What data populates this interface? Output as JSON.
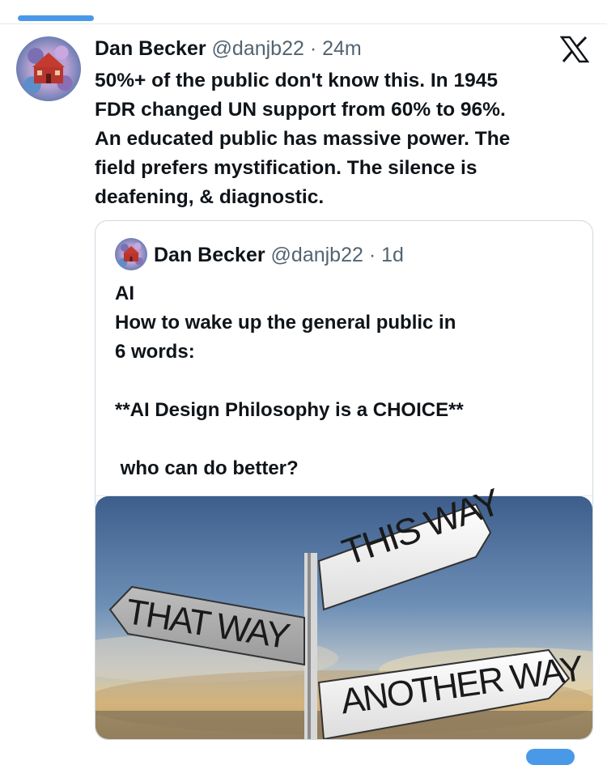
{
  "tweet": {
    "author_name": "Dan Becker",
    "handle": "@danjb22",
    "separator": "·",
    "time": "24m",
    "text": "50%+ of the public don't know this. In 1945\nFDR changed UN support from 60% to 96%.\nAn educated public has massive power. The\nfield prefers mystification. The silence is\ndeafening, & diagnostic."
  },
  "quoted_tweet": {
    "author_name": "Dan Becker",
    "handle": "@danjb22",
    "separator": "·",
    "time": "1d",
    "text": "AI\nHow to wake up the general public in\n6 words:\n\n**AI Design Philosophy is a CHOICE**\n\n who can do better?",
    "image": {
      "signs": [
        "THAT WAY",
        "THIS WAY",
        "ANOTHER WAY"
      ]
    }
  },
  "icons": {
    "platform_logo": "x-logo-icon"
  },
  "colors": {
    "text": "#0f1419",
    "secondary": "#536471",
    "accent": "#4a99e9",
    "border": "#cfd9de"
  }
}
